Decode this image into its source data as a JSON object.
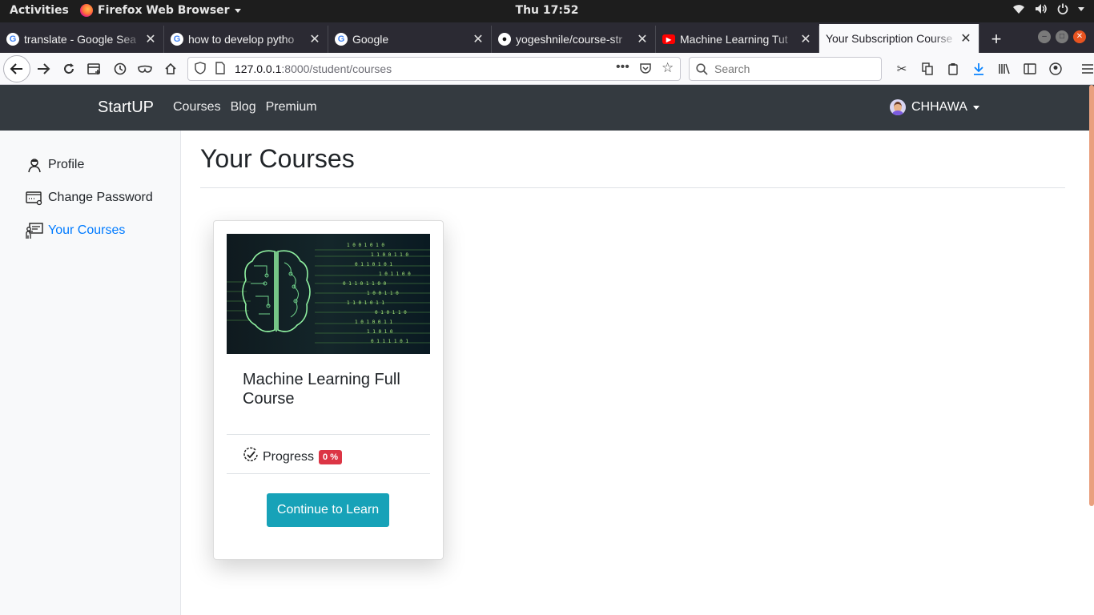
{
  "system": {
    "activities": "Activities",
    "app_name": "Firefox Web Browser",
    "clock": "Thu 17:52"
  },
  "tabs": [
    {
      "title": "translate - Google Sea",
      "favicon": "google-icon"
    },
    {
      "title": "how to develop pytho",
      "favicon": "google-icon"
    },
    {
      "title": "Google",
      "favicon": "google-icon"
    },
    {
      "title": "yogeshnile/course-str",
      "favicon": "github-icon"
    },
    {
      "title": "Machine Learning Tut",
      "favicon": "youtube-icon"
    },
    {
      "title": "Your Subscription Course",
      "favicon": "none",
      "active": true
    }
  ],
  "urlbar": {
    "host": "127.0.0.1",
    "path": ":8000/student/courses"
  },
  "search": {
    "placeholder": "Search"
  },
  "site": {
    "brand": "StartUP",
    "nav": [
      "Courses",
      "Blog",
      "Premium"
    ],
    "user": "CHHAWA"
  },
  "sidebar": {
    "items": [
      {
        "label": "Profile",
        "icon": "user-icon"
      },
      {
        "label": "Change Password",
        "icon": "password-icon"
      },
      {
        "label": "Your Courses",
        "icon": "courses-icon",
        "active": true
      }
    ]
  },
  "main": {
    "title": "Your Courses"
  },
  "course": {
    "title": "Machine Learning Full Course",
    "progress_label": "Progress",
    "progress_value": "0 %",
    "button_label": "Continue to Learn"
  },
  "colors": {
    "navbar": "#343a40",
    "accent": "#007bff",
    "button": "#17a2b8",
    "badge": "#dc3545"
  }
}
